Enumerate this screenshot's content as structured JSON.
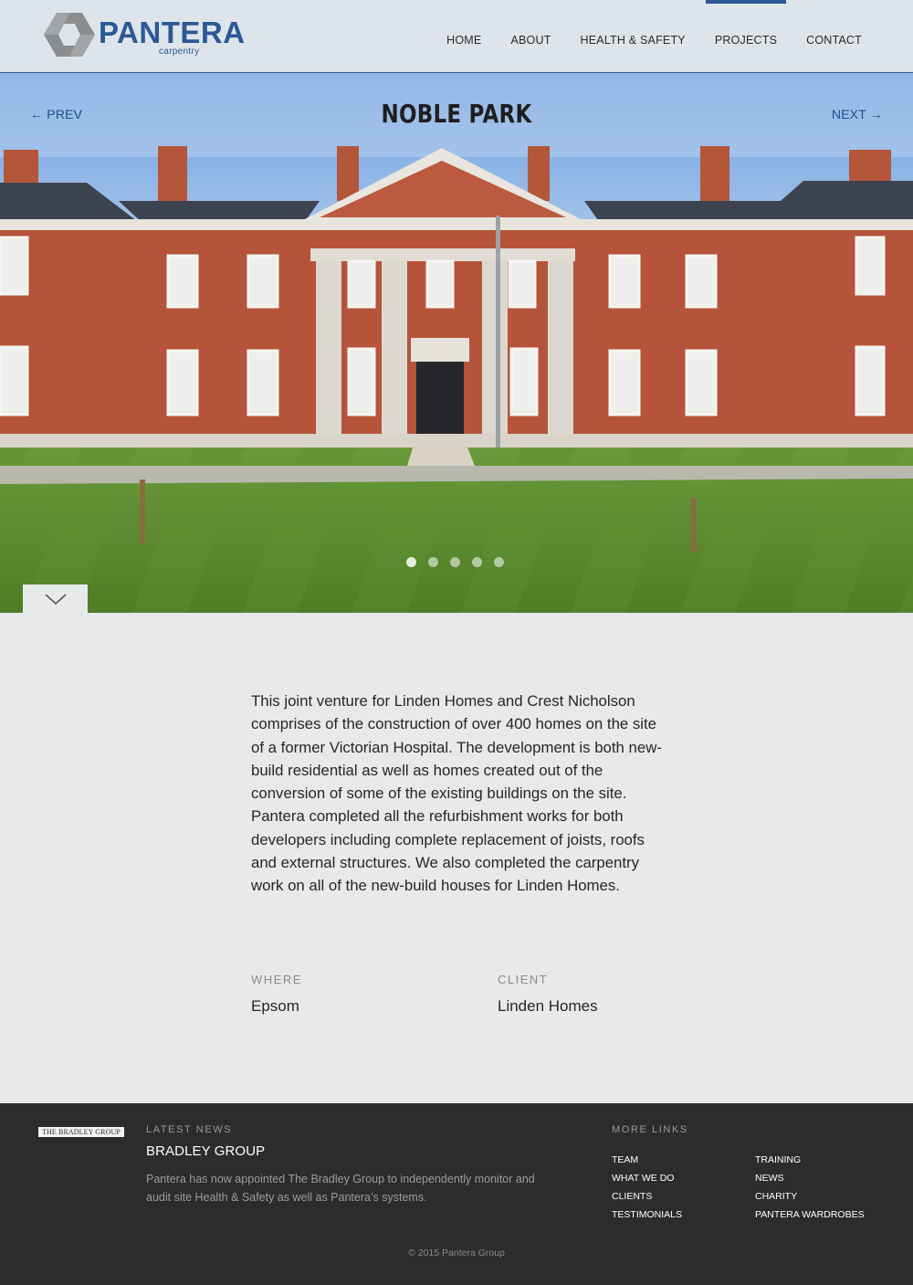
{
  "brand": {
    "name": "PANTERA",
    "tagline": "carpentry",
    "color": "#2c5896",
    "icon": "pantera-hexagon-logo-icon"
  },
  "nav": {
    "items": [
      {
        "label": "HOME",
        "active": false
      },
      {
        "label": "ABOUT",
        "active": false
      },
      {
        "label": "HEALTH & SAFETY",
        "active": false
      },
      {
        "label": "PROJECTS",
        "active": true
      },
      {
        "label": "CONTACT",
        "active": false
      }
    ]
  },
  "hero": {
    "title": "NOBLE PARK",
    "prev_label": "← PREV",
    "next_label": "NEXT →",
    "slides": 5,
    "active_slide": 1,
    "scroll_icon": "chevron-down-icon"
  },
  "project": {
    "description": "This joint venture for Linden Homes and Crest Nicholson comprises of the construction of over 400 homes on the site of a former Victorian Hospital. The development is both new-build residential as well as homes created out of the conversion of some of the existing buildings on the site. Pantera completed all the refurbishment works for both developers including complete replacement of joists, roofs and external structures. We also completed the carpentry work on all of the new-build houses for Linden Homes.",
    "where_label": "WHERE",
    "where_value": "Epsom",
    "client_label": "CLIENT",
    "client_value": "Linden Homes"
  },
  "footer": {
    "partner_logo_text": "THE BRADLEY GROUP",
    "news_label": "LATEST NEWS",
    "news_title": "BRADLEY GROUP",
    "news_body": "Pantera has now appointed The Bradley Group to independently monitor and audit site Health & Safety as well as Pantera’s systems.",
    "more_links_label": "MORE LINKS",
    "links_col1": [
      "TEAM",
      "WHAT WE DO",
      "CLIENTS",
      "TESTIMONIALS"
    ],
    "links_col2": [
      "TRAINING",
      "NEWS",
      "CHARITY",
      "PANTERA WARDROBES"
    ],
    "copyright": "© 2015 Pantera Group"
  }
}
